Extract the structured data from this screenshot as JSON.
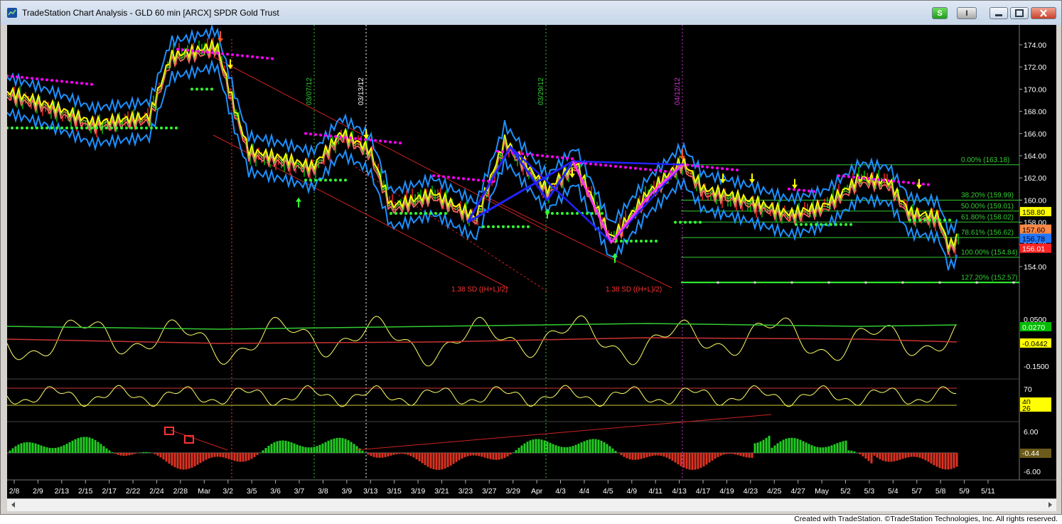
{
  "window": {
    "title": "TradeStation Chart Analysis - GLD 60 min [ARCX] SPDR Gold Trust",
    "buttons": {
      "s_label": "S",
      "i_label": "I",
      "minimize": "",
      "restore": "",
      "close": "×"
    }
  },
  "footer": "Created with TradeStation. ©TradeStation Technologies, Inc. All rights reserved.",
  "colors": {
    "background": "#000000",
    "price_up": "#00cc00",
    "price_down": "#ff2a2a",
    "bollinger": "#1e90ff",
    "ma_yellow": "#ffff00",
    "ma_red": "#ff6666",
    "magenta_dots": "#ff00ff",
    "green_dots": "#33ff33",
    "pattern_blue": "#2222ff",
    "pattern_magenta": "#ff33ff",
    "fib_line": "#33cc33"
  },
  "date_labels": [
    "2/8",
    "2/9",
    "2/13",
    "2/15",
    "2/17",
    "2/22",
    "2/24",
    "2/28",
    "Mar",
    "3/2",
    "3/5",
    "3/6",
    "3/7",
    "3/8",
    "3/9",
    "3/13",
    "3/15",
    "3/19",
    "3/21",
    "3/23",
    "3/27",
    "3/29",
    "Apr",
    "4/3",
    "4/4",
    "4/5",
    "4/9",
    "4/11",
    "4/13",
    "4/17",
    "4/19",
    "4/23",
    "4/25",
    "4/27",
    "May",
    "5/2",
    "5/3",
    "5/4",
    "5/7",
    "5/8",
    "5/9",
    "5/11"
  ],
  "vertical_markers": [
    {
      "label": "03/07/12",
      "color": "#33cc33"
    },
    {
      "label": "03/13/12",
      "color": "#ffffff"
    },
    {
      "label": "03/29/12",
      "color": "#33cc33"
    },
    {
      "label": "04/12/12",
      "color": "#cc33cc"
    }
  ],
  "price_axis": [
    "174.00",
    "172.00",
    "170.00",
    "168.00",
    "166.00",
    "164.00",
    "162.00",
    "160.00",
    "158.00",
    "156.00",
    "154.00"
  ],
  "price_tags": [
    {
      "value": "158.80",
      "bg": "#ffff00",
      "fg": "#000000"
    },
    {
      "value": "157.60",
      "bg": "#ff8844",
      "fg": "#000000"
    },
    {
      "value": "156.78",
      "bg": "#2277ff",
      "fg": "#000000"
    },
    {
      "value": "156.01",
      "bg": "#ff2222",
      "fg": "#ffffff"
    }
  ],
  "fib_levels": [
    {
      "label": "0.00% (163.18)"
    },
    {
      "label": "38.20% (159.99)"
    },
    {
      "label": "50.00% (159.01)"
    },
    {
      "label": "61.80% (158.02)"
    },
    {
      "label": "78.61% (156.62)"
    },
    {
      "label": "100.00% (154.84)"
    },
    {
      "label": "127.20% (152.57)"
    }
  ],
  "sd_labels": [
    "1.38 SD ((H+L)/2)",
    "1.38 SD ((H+L)/2)"
  ],
  "oscillator": {
    "axis": [
      "0.0500",
      "-0.1500"
    ],
    "tags": [
      {
        "value": "0.0270",
        "bg": "#00bb00",
        "fg": "#ffffff"
      },
      {
        "value": "-0.0442",
        "bg": "#ffff00",
        "fg": "#000000"
      }
    ]
  },
  "rsi": {
    "axis": [
      "70",
      "30"
    ],
    "tags": [
      {
        "value": "40",
        "bg": "#ffff00",
        "fg": "#000000"
      },
      {
        "value": "26",
        "bg": "#ffff00",
        "fg": "#000000"
      }
    ]
  },
  "histogram": {
    "axis": [
      "6.00",
      "-6.00"
    ],
    "tags": [
      {
        "value": "-0.44",
        "bg": "#6b5a1a",
        "fg": "#ffffff"
      }
    ]
  }
}
